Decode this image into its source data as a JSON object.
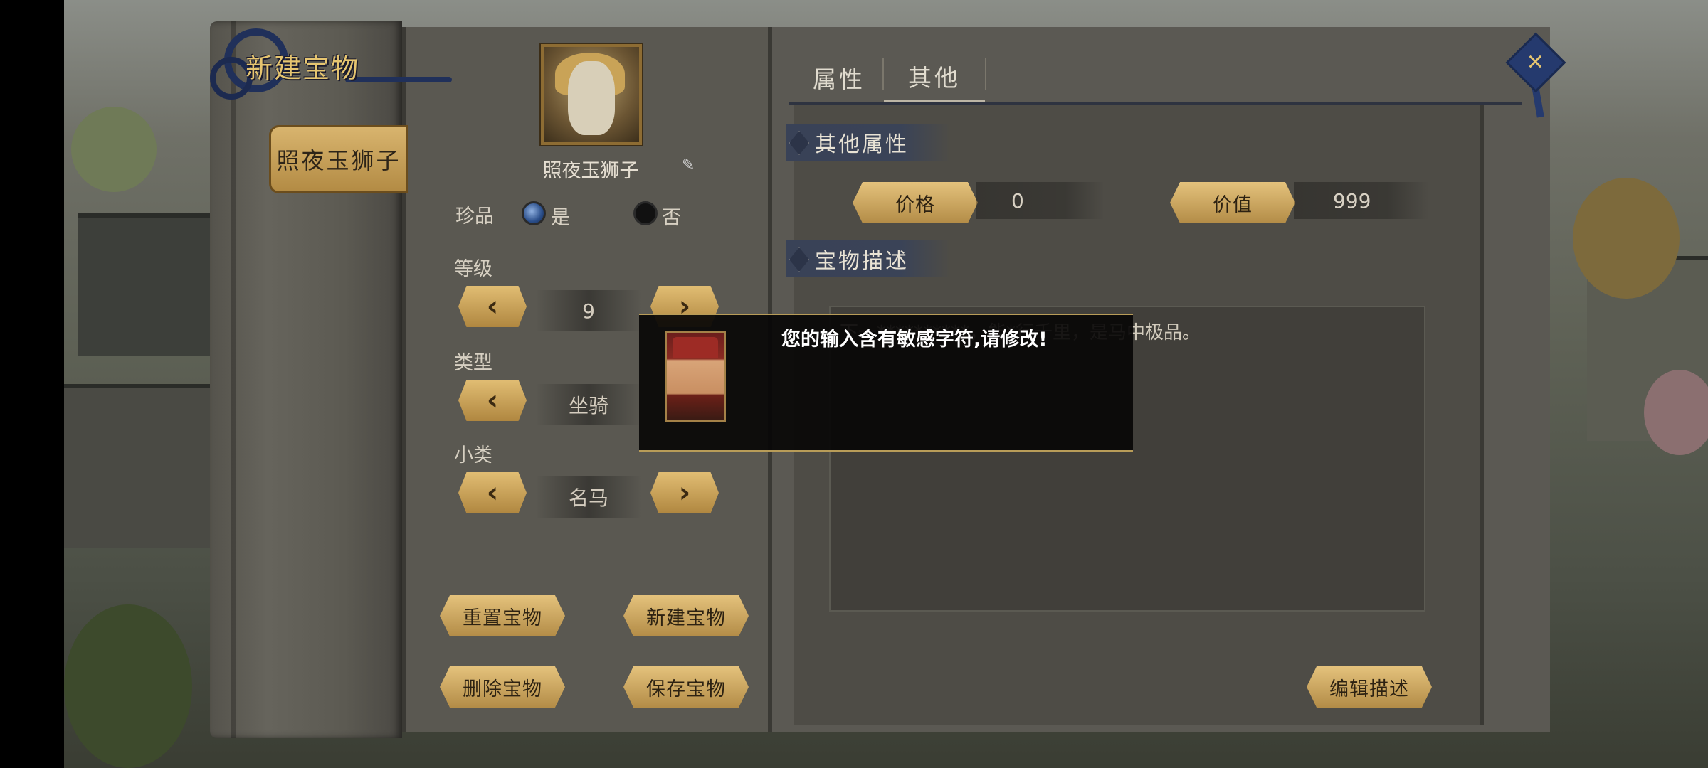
{
  "window_title": "新建宝物",
  "item_tab": "照夜玉狮子",
  "item": {
    "name": "照夜玉狮子",
    "portrait_icon": "white-horse-portrait",
    "edit_icon": "pencil-icon"
  },
  "treasure_flag": {
    "label": "珍品",
    "yes": "是",
    "no": "否",
    "selected": "是"
  },
  "level": {
    "label": "等级",
    "value": "9"
  },
  "type": {
    "label": "类型",
    "value": "坐骑"
  },
  "subtype": {
    "label": "小类",
    "value": "名马"
  },
  "arrows": {
    "prev": "‹",
    "next": "›"
  },
  "buttons": {
    "reset": "重置宝物",
    "create": "新建宝物",
    "delete": "删除宝物",
    "save": "保存宝物",
    "edit_desc": "编辑描述"
  },
  "tabs": [
    {
      "label": "属性"
    },
    {
      "label": "其他",
      "active": true
    }
  ],
  "other_section": {
    "title": "其他属性",
    "price_label": "价格",
    "price_value": "0",
    "worth_label": "价值",
    "worth_value": "999"
  },
  "desc_section": {
    "title": "宝物描述",
    "text": "下一**********，能*行千里，是马中极品。"
  },
  "dialog": {
    "message": "您的输入含有敏感字符,请修改!",
    "portrait_icon": "official-portrait"
  },
  "close_icon": "close-icon",
  "colors": {
    "gold": "#d8b46e",
    "navy": "#253a6e",
    "panel": "#5a5851"
  }
}
